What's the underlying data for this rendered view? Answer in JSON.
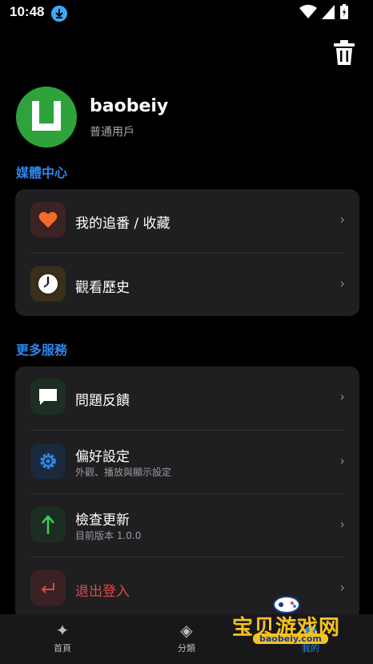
{
  "status": {
    "time": "10:48"
  },
  "profile": {
    "name": "baobeiy",
    "role": "普通用戶"
  },
  "media_section": {
    "title": "媒體中心",
    "items": [
      {
        "label": "我的追番 / 收藏",
        "icon": "heart-icon",
        "color": "#f26b2b"
      },
      {
        "label": "觀看歷史",
        "icon": "clock-icon",
        "color": "#f0b440"
      }
    ]
  },
  "more_section": {
    "title": "更多服務",
    "items": [
      {
        "label": "問題反饋",
        "icon": "chat-icon",
        "color": "#ffffff"
      },
      {
        "label": "偏好設定",
        "sub": "外觀、播放與顯示設定",
        "icon": "gear-icon",
        "color": "#2f86e8"
      },
      {
        "label": "檢查更新",
        "sub": "目前版本 1.0.0",
        "icon": "arrow-up-icon",
        "color": "#3ccf5a"
      },
      {
        "label": "退出登入",
        "icon": "logout-icon",
        "color": "#e24646"
      }
    ]
  },
  "chevron": "›",
  "tabs": [
    {
      "label": "首頁",
      "icon": "sparkle-icon"
    },
    {
      "label": "分類",
      "icon": "diamond-icon"
    },
    {
      "label": "我的",
      "icon": "user-icon"
    }
  ],
  "watermark": {
    "title": "宝贝游戏网",
    "url": "baobeiy.com"
  }
}
